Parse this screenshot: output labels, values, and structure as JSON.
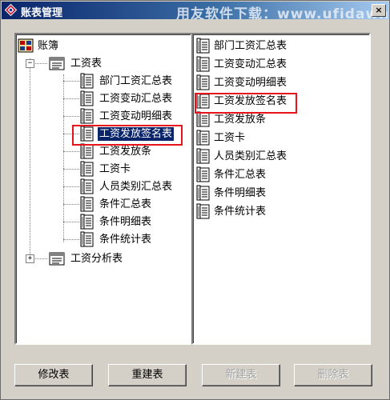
{
  "window": {
    "title": "账表管理",
    "watermark": "用友软件下载：www.ufidawhy.com",
    "close_symbol": "×"
  },
  "tree": {
    "root": {
      "label": "账簿"
    },
    "groups": [
      {
        "label": "工资表",
        "expander": "−",
        "expanded": true,
        "children": [
          "部门工资汇总表",
          "工资变动汇总表",
          "工资变动明细表",
          "工资发放签名表",
          "工资发放条",
          "工资卡",
          "人员类别汇总表",
          "条件汇总表",
          "条件明细表",
          "条件统计表"
        ],
        "selected_index": 3
      },
      {
        "label": "工资分析表",
        "expander": "+",
        "expanded": false
      }
    ]
  },
  "report_list": {
    "items": [
      "部门工资汇总表",
      "工资变动汇总表",
      "工资变动明细表",
      "工资发放签名表",
      "工资发放条",
      "工资卡",
      "人员类别汇总表",
      "条件汇总表",
      "条件明细表",
      "条件统计表"
    ],
    "highlighted_index": 3
  },
  "buttons": {
    "modify": "修改表",
    "rebuild": "重建表",
    "new": "新建表",
    "delete": "删除表"
  },
  "colors": {
    "selection": "#0a246a",
    "highlight_box": "#e8141c",
    "titlebar_start": "#0a246a"
  }
}
